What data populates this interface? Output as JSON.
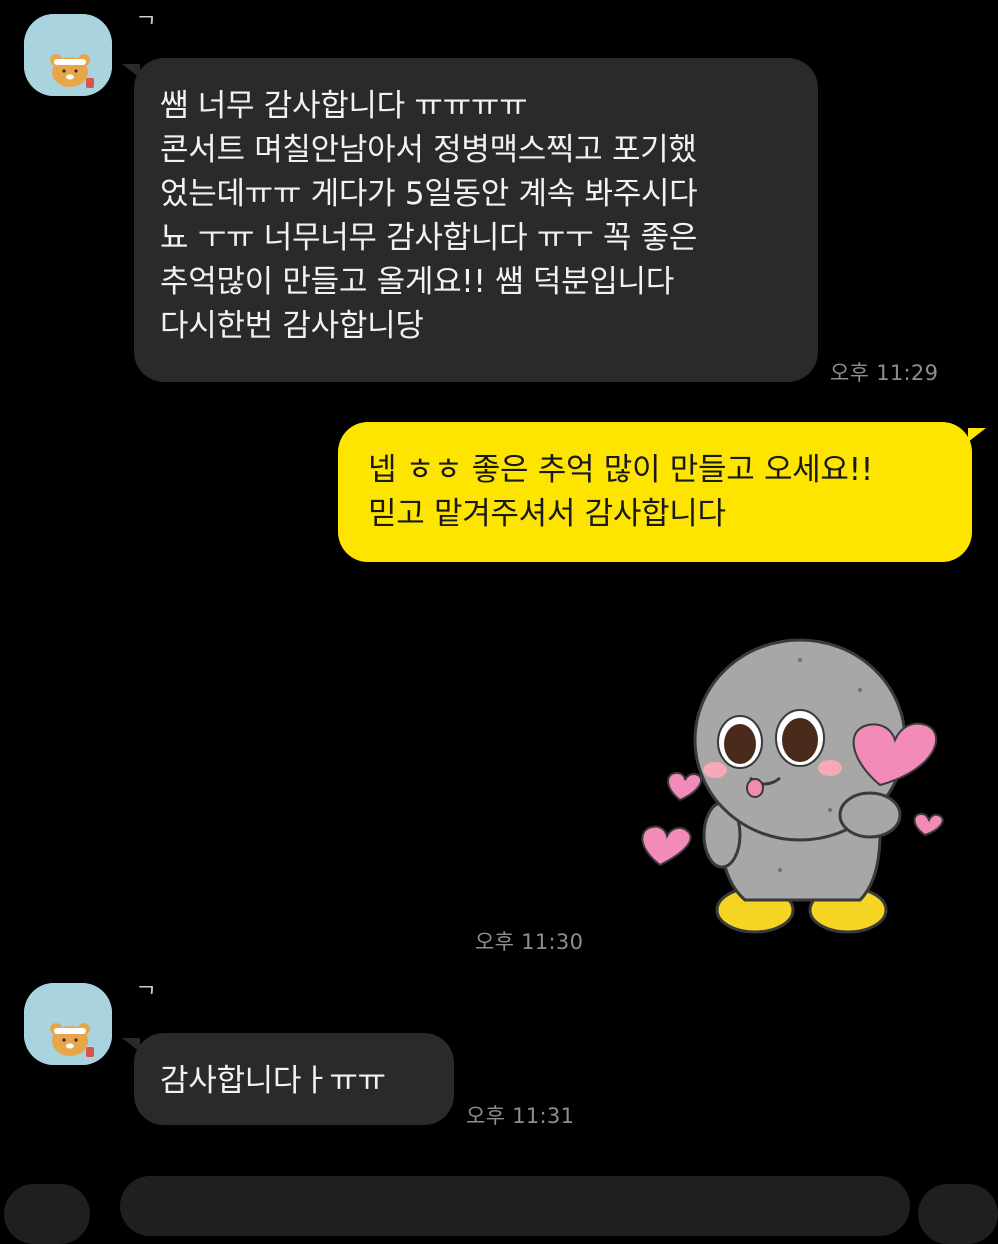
{
  "chat": {
    "messages": [
      {
        "sender_name": "ᄀ",
        "text": "쌤 너무 감사합니다 ㅠㅠㅠㅠ\n콘서트 며칠안남아서 정병맥스찍고 포기했\n었는데ㅠㅠ 게다가 5일동안 계속 봐주시다\n뇨 ㅜㅠ 너무너무 감사합니다 ㅠㅜ 꼭 좋은\n추억많이 만들고 올게요!! 쌤 덕분입니다\n다시한번 감사합니당",
        "time": "오후 11:29"
      },
      {
        "text": "넵 ㅎㅎ 좋은 추억 많이 만들고 오세요!!\n믿고 맡겨주셔서 감사합니다"
      },
      {
        "sticker": "gray-doll-heart-sticker",
        "time": "오후 11:30"
      },
      {
        "sender_name": "ᄀ",
        "text": "감사합니다ㅏㅠㅠ",
        "time": "오후 11:31"
      }
    ]
  },
  "colors": {
    "background": "#000000",
    "incoming_bubble": "#2a2a2a",
    "outgoing_bubble": "#fee500",
    "timestamp": "#8e8e8e"
  },
  "icons": {
    "avatar": "ryan-character-avatar-icon",
    "sticker": "gray-doll-heart-sticker"
  }
}
